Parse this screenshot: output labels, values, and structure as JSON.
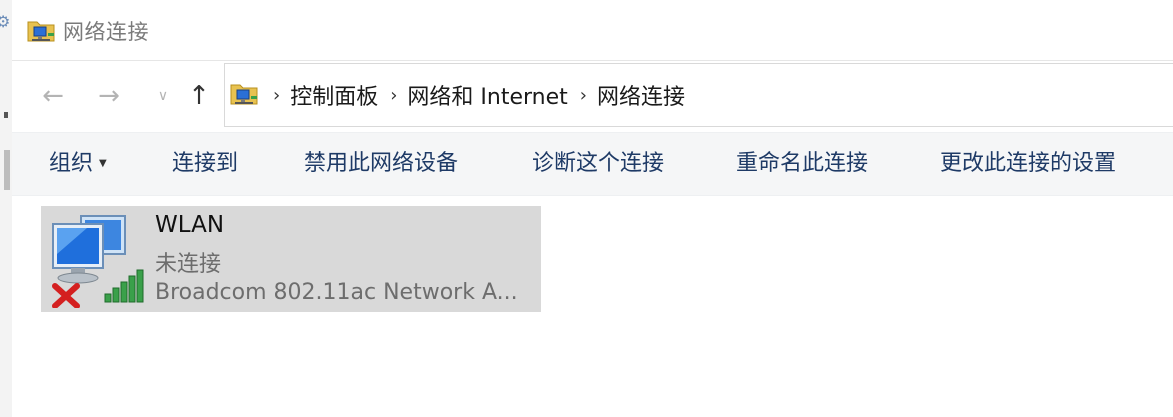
{
  "window": {
    "title": "网络连接"
  },
  "nav": {
    "back_icon": "back-arrow-icon",
    "forward_icon": "forward-arrow-icon",
    "recent_icon": "chevron-down-icon",
    "up_icon": "up-arrow-icon"
  },
  "address": {
    "breadcrumbs": [
      "控制面板",
      "网络和 Internet",
      "网络连接"
    ]
  },
  "toolbar": {
    "organize": "组织",
    "connect_to": "连接到",
    "disable_device": "禁用此网络设备",
    "diagnose": "诊断这个连接",
    "rename": "重命名此连接",
    "change_settings": "更改此连接的设置"
  },
  "connections": [
    {
      "name": "WLAN",
      "status": "未连接",
      "adapter": "Broadcom 802.11ac Network A...",
      "status_icon": "red-x-icon",
      "signal_icon": "signal-bars-icon",
      "selected": true
    }
  ],
  "colors": {
    "toolbar_text": "#1e3a66",
    "selection_bg": "#d9d9d9",
    "error_red": "#d42020",
    "signal_green": "#3aa04a"
  }
}
